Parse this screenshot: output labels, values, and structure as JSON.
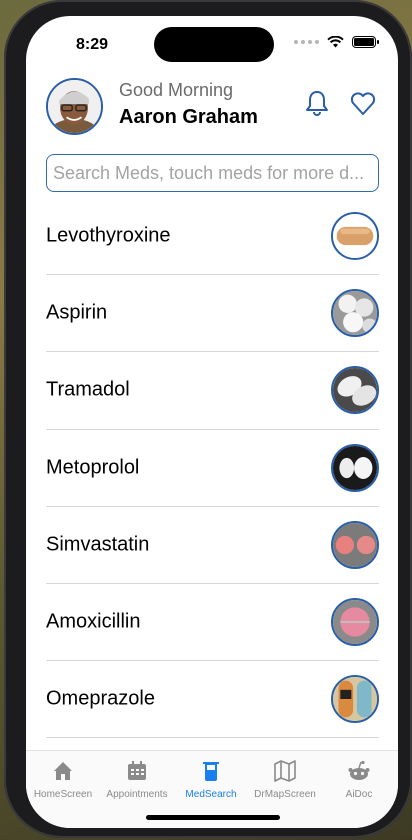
{
  "status": {
    "time": "8:29"
  },
  "header": {
    "greeting": "Good Morning",
    "user_name": "Aaron Graham"
  },
  "search": {
    "placeholder": "Search Meds, touch meds for more d..."
  },
  "meds": [
    {
      "name": "Levothyroxine",
      "pill_icon": "oblong-tan-tablet"
    },
    {
      "name": "Aspirin",
      "pill_icon": "white-round-tablets"
    },
    {
      "name": "Tramadol",
      "pill_icon": "white-oval-tablets"
    },
    {
      "name": "Metoprolol",
      "pill_icon": "white-round-tablet-pair"
    },
    {
      "name": "Simvastatin",
      "pill_icon": "pink-round-tablets"
    },
    {
      "name": "Amoxicillin",
      "pill_icon": "pink-capsule"
    },
    {
      "name": "Omeprazole",
      "pill_icon": "teal-orange-capsule"
    }
  ],
  "tabs": [
    {
      "label": "HomeScreen",
      "icon": "home-icon",
      "active": false
    },
    {
      "label": "Appointments",
      "icon": "calendar-icon",
      "active": false
    },
    {
      "label": "MedSearch",
      "icon": "beaker-icon",
      "active": true
    },
    {
      "label": "DrMapScreen",
      "icon": "map-icon",
      "active": false
    },
    {
      "label": "AiDoc",
      "icon": "robot-icon",
      "active": false
    }
  ],
  "colors": {
    "accent": "#1a7ff0",
    "border_blue": "#2a5ea8",
    "inactive": "#8a8a8a"
  }
}
